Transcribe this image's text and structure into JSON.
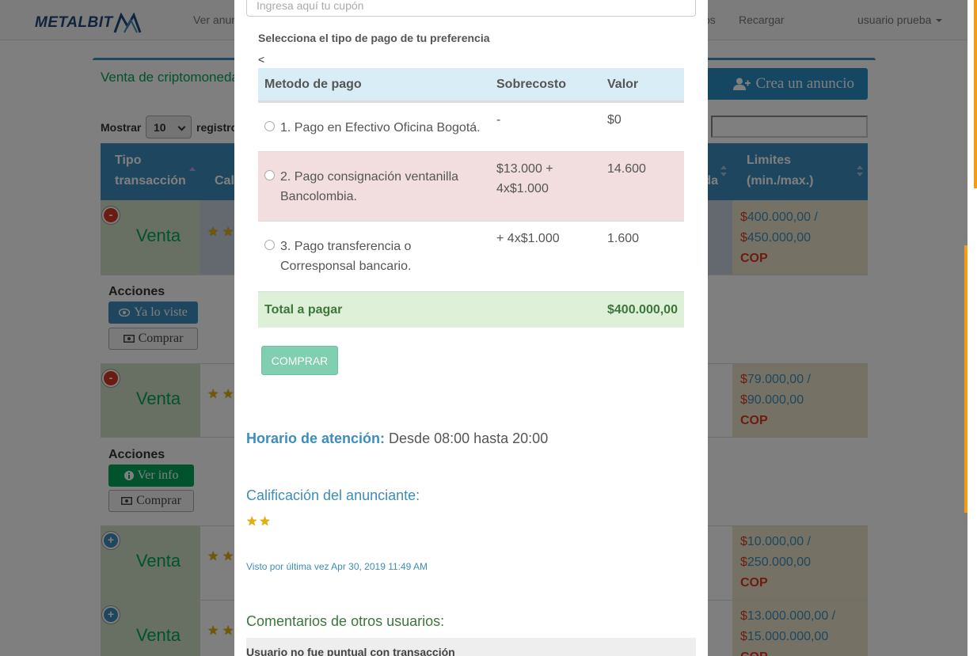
{
  "nav": {
    "logo": "METALBIT",
    "links": [
      "Ver anuncios",
      "os",
      "Recargar"
    ],
    "user": "usuario prueba"
  },
  "panel": {
    "title": "Venta de criptomonedas",
    "create_button": "Crea un anuncio",
    "show_label": "Mostrar",
    "show_value": "10",
    "show_suffix": "registros",
    "columns": {
      "type": "Tipo transacción",
      "rating": "Calificación",
      "coin": "Moneda",
      "limits": "Limites (min./max.)"
    },
    "rows": [
      {
        "type": "Venta",
        "limit_min": "400.000,00 /",
        "limit_max": "450.000,00",
        "currency": "COP",
        "expanded": true
      },
      {
        "type": "Venta",
        "limit_min": "79.000,00 /",
        "limit_max": "90.000,00",
        "currency": "COP",
        "expanded": true
      },
      {
        "type": "Venta",
        "limit_min": "10.000,00 /",
        "limit_max": "250.000,00",
        "currency": "COP",
        "expanded": false
      },
      {
        "type": "Venta",
        "limit_min": "13.000.000,00 /",
        "limit_max": "15.000.000,00",
        "currency": "COP",
        "expanded": false
      }
    ],
    "actions": {
      "label": "Acciones",
      "seen_button": "Ya lo viste",
      "info_button": "Ver info",
      "buy_button": "Comprar"
    },
    "dollar": "$"
  },
  "modal": {
    "coupon_placeholder": "Ingresa aquí tu cupón",
    "payment_pref": "Selecciona el tipo de pago de tu preferencia",
    "stray": "<",
    "table": {
      "headers": [
        "Metodo de pago",
        "Sobrecosto",
        "Valor"
      ],
      "rows": [
        {
          "method": "1. Pago en Efectivo Oficina Bogotá.",
          "extra": "-",
          "value": "$0"
        },
        {
          "method": "2. Pago consignación ventanilla Bancolombia.",
          "extra": "$13.000 + 4x$1.000",
          "value": "14.600"
        },
        {
          "method": "3. Pago transferencia o Corresponsal bancario.",
          "extra": "+ 4x$1.000",
          "value": "1.600"
        }
      ],
      "total_label": "Total a pagar",
      "total_value": "$400.000,00"
    },
    "buy_button": "COMPRAR",
    "schedule_label": "Horario de atención:",
    "schedule_value": "Desde 08:00 hasta 20:00",
    "rating_title": "Calificación del anunciante:",
    "last_seen": "Visto por última vez Apr 30, 2019 11:49 AM",
    "comments_title": "Comentarios de otros usuarios:",
    "comment_1": "Usuario no fue puntual con transacción"
  },
  "colors": {
    "primary": "#3c8dbc",
    "success": "#00a65a",
    "danger": "#d73925",
    "scrollbar": "#f39c12"
  }
}
